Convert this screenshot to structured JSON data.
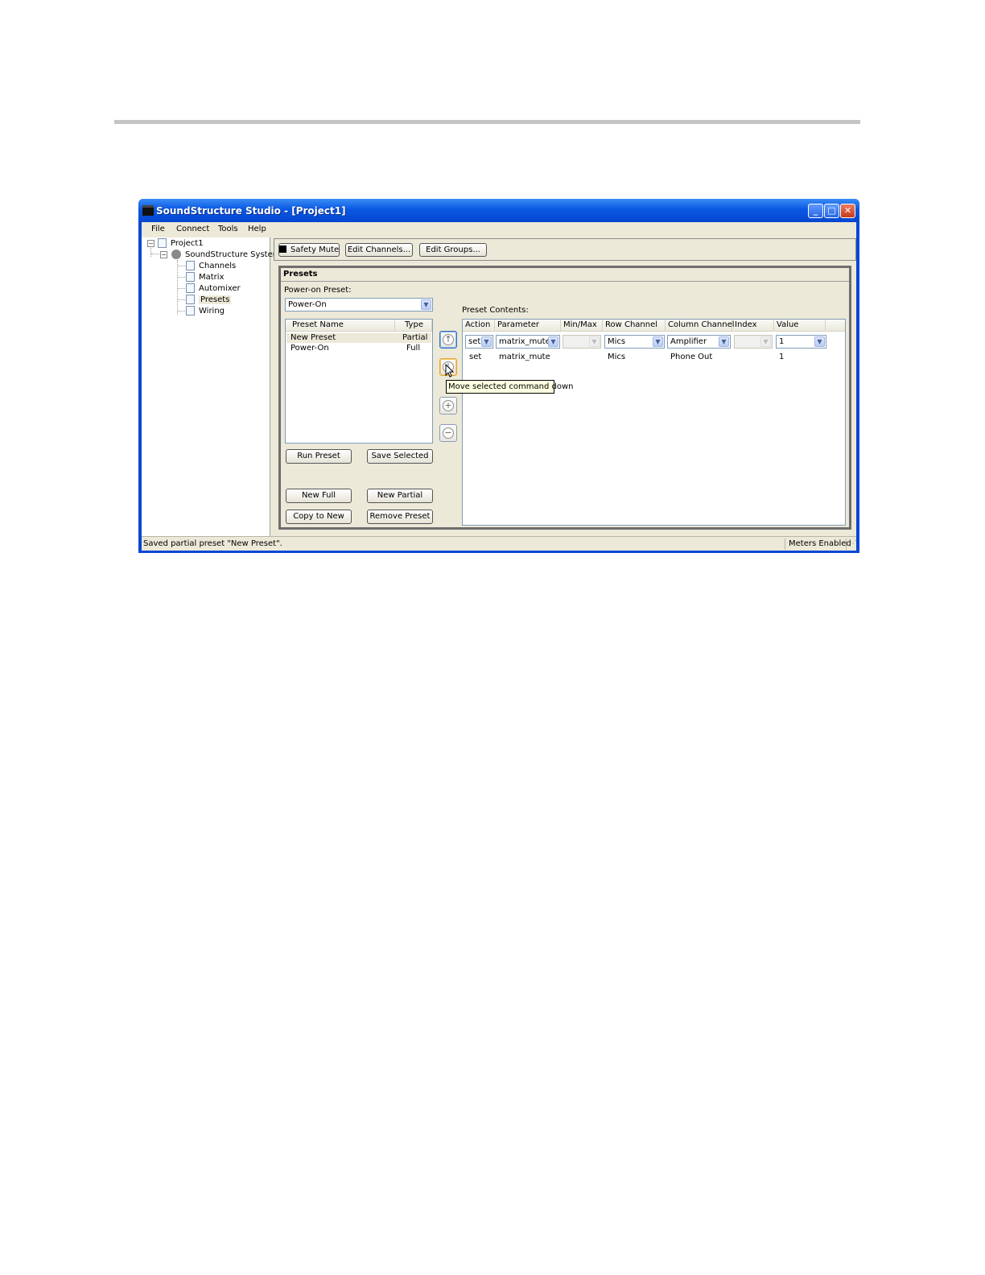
{
  "window": {
    "title": "SoundStructure Studio - [Project1]",
    "minimize_glyph": "_",
    "maximize_glyph": "□",
    "close_glyph": "✕"
  },
  "menu": {
    "items": [
      "File",
      "Connect",
      "Tools",
      "Help"
    ]
  },
  "tree": {
    "root": "Project1",
    "system": "SoundStructure System",
    "children": [
      "Channels",
      "Matrix",
      "Automixer",
      "Presets",
      "Wiring"
    ],
    "selected": "Presets",
    "expand_glyph": "−"
  },
  "toolbar": {
    "safety_mute": "Safety Mute",
    "edit_channels": "Edit Channels...",
    "edit_groups": "Edit Groups..."
  },
  "presets": {
    "panel_title": "Presets",
    "power_on_label": "Power-on Preset:",
    "power_on_value": "Power-On",
    "list_headers": [
      "Preset Name",
      "Type"
    ],
    "list_rows": [
      {
        "name": "New Preset",
        "type": "Partial"
      },
      {
        "name": "Power-On",
        "type": "Full"
      }
    ],
    "buttons": {
      "run_preset": "Run Preset",
      "save_selected": "Save Selected",
      "new_full": "New Full",
      "new_partial": "New Partial",
      "copy_to_new": "Copy to New",
      "remove_preset": "Remove Preset"
    },
    "contents_label": "Preset Contents:",
    "contents_headers": [
      "Action",
      "Parameter",
      "Min/Max",
      "Row Channel",
      "Column Channel",
      "Index",
      "Value"
    ],
    "edit_row": {
      "action": "set",
      "parameter": "matrix_mute",
      "minmax": "",
      "row_channel": "Mics",
      "column_channel": "Amplifier",
      "index": "",
      "value": "1"
    },
    "rows": [
      {
        "action": "set",
        "parameter": "matrix_mute",
        "minmax": "",
        "row_channel": "Mics",
        "column_channel": "Phone Out",
        "index": "",
        "value": "1"
      }
    ],
    "side_buttons": {
      "up_glyph": "↑",
      "down_glyph": "↓",
      "add_glyph": "+",
      "remove_glyph": "−"
    },
    "tooltip": "Move selected command down"
  },
  "status": {
    "message": "Saved partial preset \"New Preset\".",
    "meters": "Meters Enabled"
  },
  "colors": {
    "title_bar": "#0a58e3",
    "window_frame": "#0a47d6",
    "face": "#ece9d8",
    "tooltip_bg": "#ffffe1"
  }
}
